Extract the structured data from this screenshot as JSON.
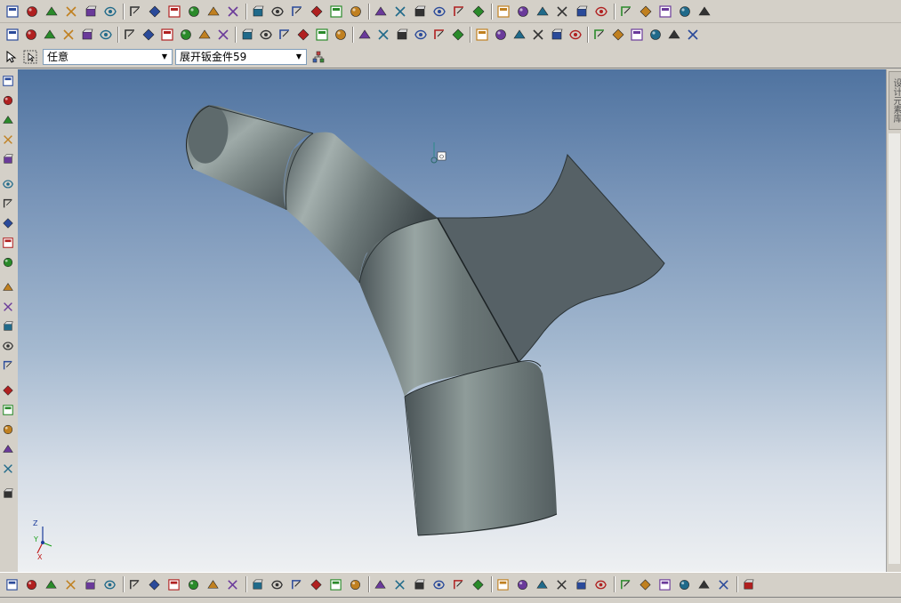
{
  "toolbar3": {
    "filter_value": "任意",
    "part_value": "展开钣金件59"
  },
  "right_panel": {
    "tab_label": "设计元素库"
  },
  "triad": {
    "z_label": "Z",
    "y_label": "Y",
    "x_label": "X"
  },
  "colors": {
    "viewport_top": "#4f73a0",
    "viewport_bottom": "#eef0f2",
    "toolbar_bg": "#d4d0c8",
    "part_body": "#6b7778",
    "flange_face": "#555f63"
  },
  "icons": {
    "toolbar1": [
      "new-document-icon",
      "close-document-icon",
      "open-folder-icon",
      "save-icon",
      "undo-icon",
      "redo-icon",
      "select-filter-icon",
      "copy-feature-icon",
      "paste-feature-icon",
      "measure-icon",
      "check-icon",
      "help-icon",
      "design-flow-icon",
      "shape-paint-icon",
      "paint-icon",
      "export-icon",
      "import-icon",
      "draw-curve-icon",
      "text-style-icon",
      "move-icon",
      "wireframe-box-icon",
      "hidden-line-box-icon",
      "shaded-sphere-icon",
      "shaded-edges-sphere-icon",
      "perspective-box-icon",
      "front-view-icon",
      "cylinder-view-icon",
      "screen-icon",
      "render-icon",
      "section-view-icon",
      "globe-icon",
      "globe-alt-icon",
      "grid-icon",
      "table-icon",
      "table-alt-icon"
    ],
    "toolbar2": [
      "extrude-icon",
      "revolve-icon",
      "sweep-icon",
      "loft-icon",
      "shell-icon",
      "blend-icon",
      "chamfer-icon",
      "fillet-icon",
      "draft-icon",
      "bend-icon",
      "unfold-icon",
      "tool-icon",
      "punch-icon",
      "flange-icon",
      "hem-icon",
      "corner-icon",
      "stamp-icon",
      "rib-icon",
      "pattern-icon",
      "mirror-icon",
      "boolean-icon",
      "split-icon",
      "face-move-icon",
      "thicken-icon",
      "offset-icon",
      "combine-icon",
      "rotate-plane-icon",
      "dimension-icon",
      "sketch-icon",
      "constraint-icon",
      "align-icon",
      "distance-icon",
      "arrow-icon",
      "ruler-icon",
      "scale-icon",
      "dropper-icon"
    ],
    "left_bar": [
      "pan-icon",
      "rotate-icon",
      "zoom-icon",
      "orbit-icon",
      "zoom-window-icon",
      "zoom-all-icon",
      "fit-icon",
      "center-icon",
      "camera-icon",
      "camera-alt-icon",
      "light-icon",
      "view-icon",
      "shaded-icon",
      "triad-tool-icon",
      "face-select-icon",
      "edge-select-icon",
      "box-icon",
      "ring-icon",
      "arc-icon",
      "circle-icon",
      "text-icon"
    ],
    "bottom_bar": [
      "drawing-view-icon",
      "section-icon",
      "detail-icon",
      "align-view-icon",
      "layer-icon",
      "delete-icon",
      "offset-line-icon",
      "trim-icon",
      "ortho-icon",
      "polyline-icon",
      "line-icon",
      "angle-line-icon",
      "tangent-line-icon",
      "connect-icon",
      "node-icon",
      "rectangle-icon",
      "diamond-icon",
      "hexagon-icon",
      "circle-icon",
      "circle2-icon",
      "circle3-icon",
      "circle4-icon",
      "circle5-icon",
      "ellipse-icon",
      "arc-icon",
      "arc2-icon",
      "arc3-icon",
      "arc4-icon",
      "point-icon",
      "trim2-icon",
      "corner-icon",
      "corner2-icon",
      "hatch-icon",
      "dimension-icon",
      "angle-dim-icon",
      "center-mark-icon",
      "leader-icon"
    ]
  }
}
